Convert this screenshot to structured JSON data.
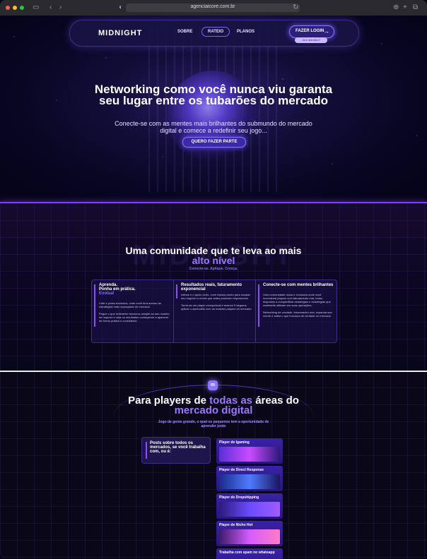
{
  "browser": {
    "url": "agenciaicore.com.br",
    "back": "‹",
    "forward": "›"
  },
  "nav": {
    "logo": "MIDNIGHT",
    "links": [
      "SOBRE",
      "RATEIO",
      "PLANOS"
    ],
    "login": "FAZER LOGIN",
    "member": "Já é membro?"
  },
  "hero": {
    "title": "Networking como você nunca viu garanta seu lugar entre os tubarões do mercado",
    "subtitle": "Conecte-se com as mentes mais brilhantes do submundo do mercado digital e comece a redefinir seu jogo...",
    "cta": "QUERO FAZER PARTE"
  },
  "community": {
    "watermark": "MIDNIGHT",
    "title_a": "Uma comunidade que te leva ao mais",
    "title_b": "alto nível",
    "tagline": "Conecte-se. Aplique. Cresça.",
    "cards": [
      {
        "title": "Aprenda.\nPonha em prática.",
        "emph": "Evolua!",
        "text": "Cafe e posta exclusiva, onde você terá acesso as estratégias mais avançadas do mercado.\n\nPegue o que realmente funciona, adapte ao seu modelo de negócio e veja os resultados começarem a aparecer de forma prática e consistente."
      },
      {
        "title": "Resultados reais, faturamento exponencial",
        "emph": "",
        "text": "Iolthos e o apoio certo, você estará pronto para escalar seu negócio a níveis que antes pareciam impossíveis.\n\nTorne-se um player excepcional e avance 5 degraus aplicar o aprendido com os maiores players do mercado"
      },
      {
        "title": "Conecte-se com mentes brilhantes",
        "emph": "",
        "text": "Uma comunidade única e exclusiva onde você encontrará players com faturamento real, todos dispostos a compartilhar estratégias e estratégias que realmente utilizam em suas operações.\n\nNetworking de verdade, faturamento real, expanda sua mente e saiba o que funciona de verdade no mercado"
      }
    ]
  },
  "players": {
    "badge": "m",
    "title_a": "Para players de",
    "title_hl1": "todas as",
    "title_b": "áreas do",
    "title_hl2": "mercado digital",
    "subtitle": "Jogo de gente grande, o qual os pequenos tem a oportunidade de aprender junto",
    "posts": "Posts sobre todos os mercados, se você trabalha com, ou é:",
    "items": [
      "Player de Igaming",
      "Player de Direct Response",
      "Player de Dropshipping",
      "Player de Nicho Hot",
      "Trabalha com spam no whatsapp"
    ]
  },
  "colors": {
    "accent": "#8b74ff",
    "highlight": "#9b78ff",
    "line": "#7b3cff"
  }
}
